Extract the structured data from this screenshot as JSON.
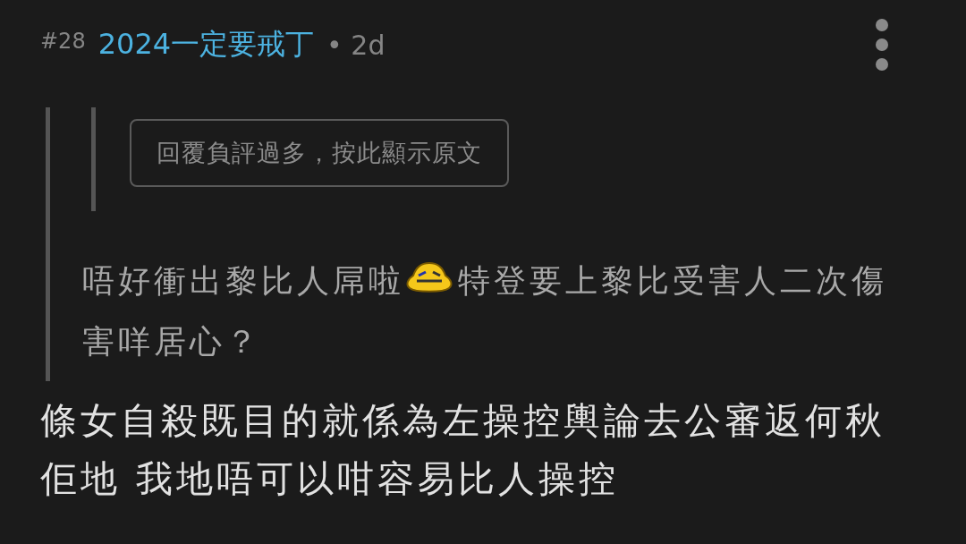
{
  "post": {
    "number": "#28",
    "author": "2024一定要戒丁",
    "time": "• 2d"
  },
  "quote": {
    "hidden_reply_button": "回覆負評過多，按此顯示原文",
    "text_before": "唔好衝出黎比人屌啦",
    "text_after": "特登要上黎比受害人二次傷",
    "text_continued": "害咩居心？"
  },
  "body": "條女自殺既目的就係為左操控輿論去公審返何秋佢地 我地唔可以咁容易比人操控"
}
